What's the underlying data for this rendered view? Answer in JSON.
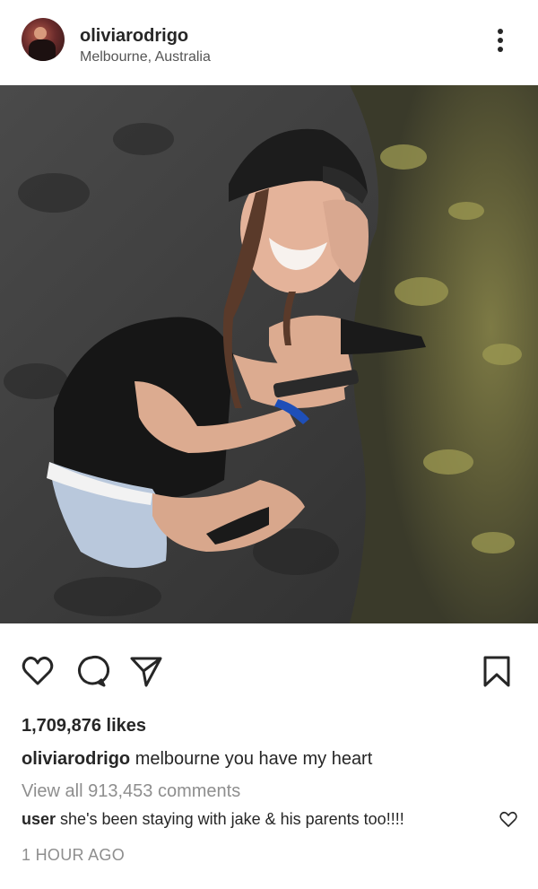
{
  "post": {
    "username": "oliviarodrigo",
    "location": "Melbourne, Australia",
    "likes_text": "1,709,876 likes",
    "caption_user": "oliviarodrigo",
    "caption_text": "melbourne you have my heart",
    "view_comments_text": "View all 913,453 comments",
    "comment_user": "user",
    "comment_text": "she's been staying with jake & his parents too!!!!",
    "timestamp": "1 HOUR AGO"
  },
  "icons": {
    "more": "more-vertical-icon",
    "like": "heart-icon",
    "comment": "comment-bubble-icon",
    "share": "paper-plane-icon",
    "save": "bookmark-icon"
  },
  "colors": {
    "text": "#262626",
    "muted": "#8e8e8e"
  }
}
